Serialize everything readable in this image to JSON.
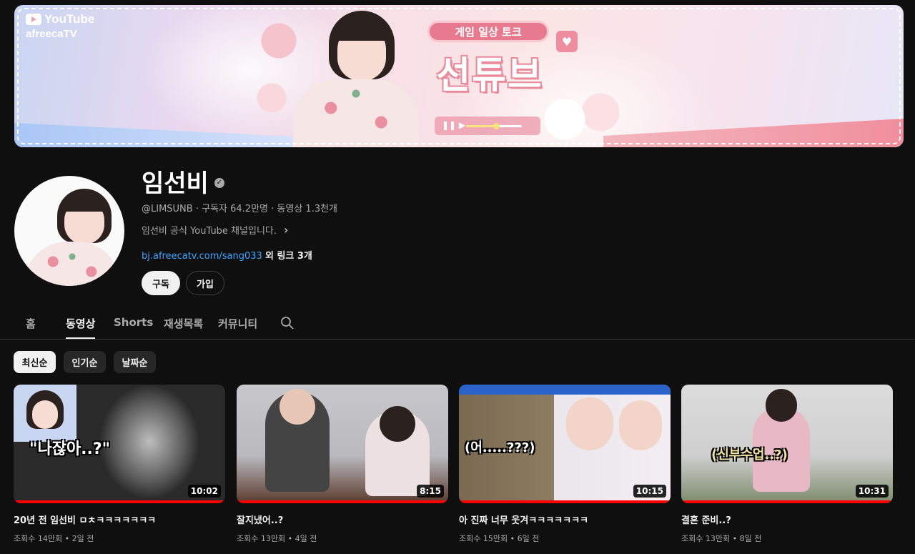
{
  "banner": {
    "logo_youtube": "YouTube",
    "logo_afreeca": "afreecaTV",
    "tag": "게임 일상 토크",
    "title": "선튜브"
  },
  "channel": {
    "name": "임선비",
    "handle": "@LIMSUNB",
    "subscribers": "구독자 64.2만명",
    "videos_count": "동영상 1.3천개",
    "description": "임선비 공식 YouTube 채널입니다.",
    "link_url": "bj.afreecatv.com/sang033",
    "link_more": "외 링크 3개",
    "subscribe_label": "구독",
    "join_label": "가입"
  },
  "tabs": [
    {
      "label": "홈",
      "active": false
    },
    {
      "label": "동영상",
      "active": true
    },
    {
      "label": "Shorts",
      "active": false
    },
    {
      "label": "재생목록",
      "active": false
    },
    {
      "label": "커뮤니티",
      "active": false
    }
  ],
  "filters": [
    {
      "label": "최신순",
      "active": true
    },
    {
      "label": "인기순",
      "active": false
    },
    {
      "label": "날짜순",
      "active": false
    }
  ],
  "videos": [
    {
      "title": "20년 전 임선비 ㅁㅊㅋㅋㅋㅋㅋㅋㅋ",
      "views": "조회수 14만회",
      "age": "2일 전",
      "duration": "10:02",
      "caption": "\"나잖아..?\"",
      "watched": 1.0
    },
    {
      "title": "잘지냈어..?",
      "views": "조회수 13만회",
      "age": "4일 전",
      "duration": "8:15",
      "caption": "",
      "watched": 1.0
    },
    {
      "title": "아 진짜 너무 웃겨ㅋㅋㅋㅋㅋㅋㅋ",
      "views": "조회수 15만회",
      "age": "6일 전",
      "duration": "10:15",
      "caption": "(어.....???)",
      "watched": 1.0
    },
    {
      "title": "결혼 준비..?",
      "views": "조회수 13만회",
      "age": "8일 전",
      "duration": "10:31",
      "caption": "(신부수업..?)",
      "watched": 1.0
    }
  ],
  "colors": {
    "background": "#0f0f0f",
    "link": "#3ea6ff",
    "progress": "#ff0000"
  }
}
